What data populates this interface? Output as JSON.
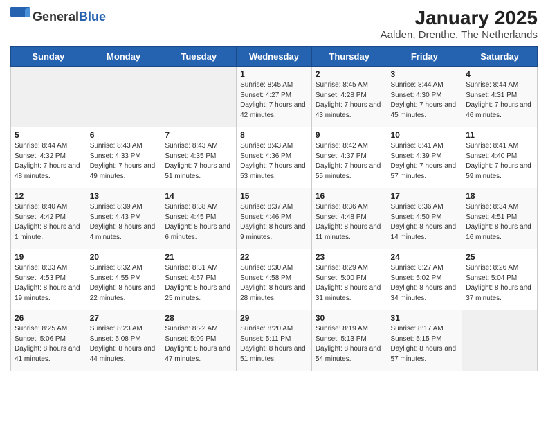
{
  "header": {
    "logo_general": "General",
    "logo_blue": "Blue",
    "title": "January 2025",
    "subtitle": "Aalden, Drenthe, The Netherlands"
  },
  "days_of_week": [
    "Sunday",
    "Monday",
    "Tuesday",
    "Wednesday",
    "Thursday",
    "Friday",
    "Saturday"
  ],
  "weeks": [
    [
      {
        "day": "",
        "info": ""
      },
      {
        "day": "",
        "info": ""
      },
      {
        "day": "",
        "info": ""
      },
      {
        "day": "1",
        "info": "Sunrise: 8:45 AM\nSunset: 4:27 PM\nDaylight: 7 hours and 42 minutes."
      },
      {
        "day": "2",
        "info": "Sunrise: 8:45 AM\nSunset: 4:28 PM\nDaylight: 7 hours and 43 minutes."
      },
      {
        "day": "3",
        "info": "Sunrise: 8:44 AM\nSunset: 4:30 PM\nDaylight: 7 hours and 45 minutes."
      },
      {
        "day": "4",
        "info": "Sunrise: 8:44 AM\nSunset: 4:31 PM\nDaylight: 7 hours and 46 minutes."
      }
    ],
    [
      {
        "day": "5",
        "info": "Sunrise: 8:44 AM\nSunset: 4:32 PM\nDaylight: 7 hours and 48 minutes."
      },
      {
        "day": "6",
        "info": "Sunrise: 8:43 AM\nSunset: 4:33 PM\nDaylight: 7 hours and 49 minutes."
      },
      {
        "day": "7",
        "info": "Sunrise: 8:43 AM\nSunset: 4:35 PM\nDaylight: 7 hours and 51 minutes."
      },
      {
        "day": "8",
        "info": "Sunrise: 8:43 AM\nSunset: 4:36 PM\nDaylight: 7 hours and 53 minutes."
      },
      {
        "day": "9",
        "info": "Sunrise: 8:42 AM\nSunset: 4:37 PM\nDaylight: 7 hours and 55 minutes."
      },
      {
        "day": "10",
        "info": "Sunrise: 8:41 AM\nSunset: 4:39 PM\nDaylight: 7 hours and 57 minutes."
      },
      {
        "day": "11",
        "info": "Sunrise: 8:41 AM\nSunset: 4:40 PM\nDaylight: 7 hours and 59 minutes."
      }
    ],
    [
      {
        "day": "12",
        "info": "Sunrise: 8:40 AM\nSunset: 4:42 PM\nDaylight: 8 hours and 1 minute."
      },
      {
        "day": "13",
        "info": "Sunrise: 8:39 AM\nSunset: 4:43 PM\nDaylight: 8 hours and 4 minutes."
      },
      {
        "day": "14",
        "info": "Sunrise: 8:38 AM\nSunset: 4:45 PM\nDaylight: 8 hours and 6 minutes."
      },
      {
        "day": "15",
        "info": "Sunrise: 8:37 AM\nSunset: 4:46 PM\nDaylight: 8 hours and 9 minutes."
      },
      {
        "day": "16",
        "info": "Sunrise: 8:36 AM\nSunset: 4:48 PM\nDaylight: 8 hours and 11 minutes."
      },
      {
        "day": "17",
        "info": "Sunrise: 8:36 AM\nSunset: 4:50 PM\nDaylight: 8 hours and 14 minutes."
      },
      {
        "day": "18",
        "info": "Sunrise: 8:34 AM\nSunset: 4:51 PM\nDaylight: 8 hours and 16 minutes."
      }
    ],
    [
      {
        "day": "19",
        "info": "Sunrise: 8:33 AM\nSunset: 4:53 PM\nDaylight: 8 hours and 19 minutes."
      },
      {
        "day": "20",
        "info": "Sunrise: 8:32 AM\nSunset: 4:55 PM\nDaylight: 8 hours and 22 minutes."
      },
      {
        "day": "21",
        "info": "Sunrise: 8:31 AM\nSunset: 4:57 PM\nDaylight: 8 hours and 25 minutes."
      },
      {
        "day": "22",
        "info": "Sunrise: 8:30 AM\nSunset: 4:58 PM\nDaylight: 8 hours and 28 minutes."
      },
      {
        "day": "23",
        "info": "Sunrise: 8:29 AM\nSunset: 5:00 PM\nDaylight: 8 hours and 31 minutes."
      },
      {
        "day": "24",
        "info": "Sunrise: 8:27 AM\nSunset: 5:02 PM\nDaylight: 8 hours and 34 minutes."
      },
      {
        "day": "25",
        "info": "Sunrise: 8:26 AM\nSunset: 5:04 PM\nDaylight: 8 hours and 37 minutes."
      }
    ],
    [
      {
        "day": "26",
        "info": "Sunrise: 8:25 AM\nSunset: 5:06 PM\nDaylight: 8 hours and 41 minutes."
      },
      {
        "day": "27",
        "info": "Sunrise: 8:23 AM\nSunset: 5:08 PM\nDaylight: 8 hours and 44 minutes."
      },
      {
        "day": "28",
        "info": "Sunrise: 8:22 AM\nSunset: 5:09 PM\nDaylight: 8 hours and 47 minutes."
      },
      {
        "day": "29",
        "info": "Sunrise: 8:20 AM\nSunset: 5:11 PM\nDaylight: 8 hours and 51 minutes."
      },
      {
        "day": "30",
        "info": "Sunrise: 8:19 AM\nSunset: 5:13 PM\nDaylight: 8 hours and 54 minutes."
      },
      {
        "day": "31",
        "info": "Sunrise: 8:17 AM\nSunset: 5:15 PM\nDaylight: 8 hours and 57 minutes."
      },
      {
        "day": "",
        "info": ""
      }
    ]
  ]
}
